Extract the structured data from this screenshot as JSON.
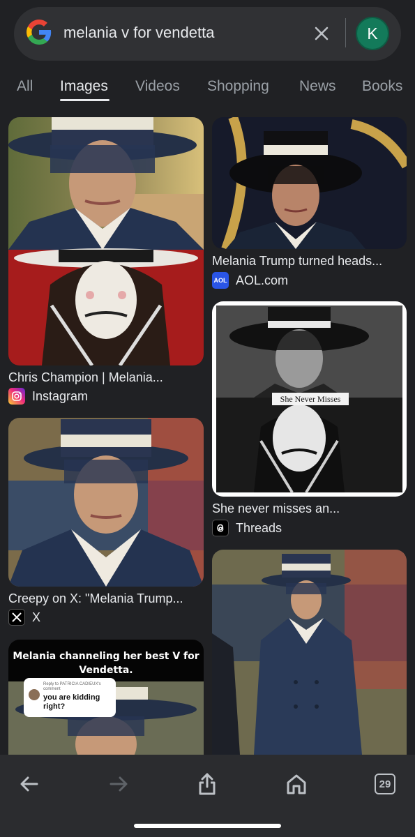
{
  "search": {
    "query": "melania v for vendetta",
    "avatar_initial": "K"
  },
  "tabs": [
    {
      "label": "All",
      "active": false
    },
    {
      "label": "Images",
      "active": true
    },
    {
      "label": "Videos",
      "active": false
    },
    {
      "label": "Shopping",
      "active": false
    },
    {
      "label": "News",
      "active": false
    },
    {
      "label": "Books",
      "active": false
    }
  ],
  "results": {
    "left": [
      {
        "title": "Chris Champion | Melania...",
        "source": "Instagram",
        "source_icon": "instagram-icon"
      },
      {
        "title": "Creepy on X: \"Melania Trump...",
        "source": "X",
        "source_icon": "x-icon"
      },
      {
        "title": "",
        "source": "",
        "overlay_caption": "Melania channeling her best V for Vendetta.",
        "comment_header": "Reply to PATRICIA CADIEUX's comment",
        "comment_text": "you are kidding right?"
      }
    ],
    "right": [
      {
        "title": "Melania Trump turned heads...",
        "source": "AOL.com",
        "source_icon": "aol-icon",
        "source_icon_text": "AOL"
      },
      {
        "title": "She never misses an...",
        "source": "Threads",
        "source_icon": "threads-icon",
        "overlay_label": "She Never Misses"
      },
      {
        "title": "",
        "source": ""
      }
    ]
  },
  "bottom_bar": {
    "tab_count": "29"
  },
  "colors": {
    "background": "#202124",
    "search_bar": "#303134",
    "avatar": "#137a5a",
    "active_tab_underline": "#e8eaed"
  }
}
